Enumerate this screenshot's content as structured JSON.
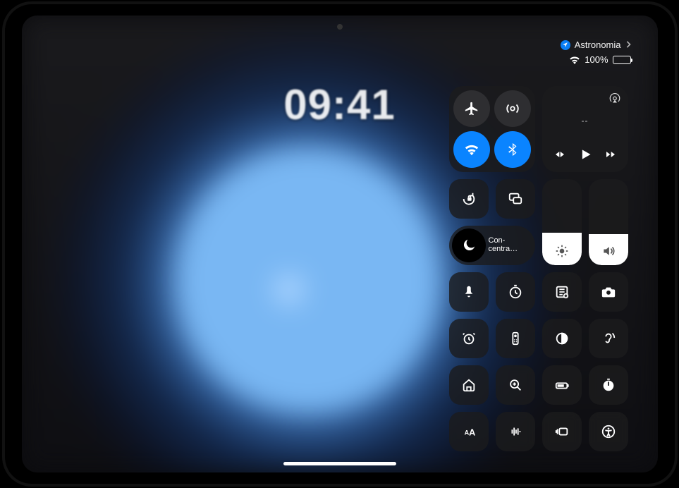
{
  "status": {
    "app_name": "Astronomia",
    "battery_text": "100%",
    "battery_level": 100
  },
  "clock": "09:41",
  "media": {
    "track_placeholder": "--"
  },
  "focus": {
    "label": "Con-\ncentra…"
  },
  "sliders": {
    "brightness_pct": 38,
    "volume_pct": 36
  },
  "controls": {
    "orientation_lock": "orientation-lock",
    "screen_mirroring": "screen-mirroring",
    "silent": "silent-mode",
    "timer": "timer",
    "notes": "quick-note",
    "camera": "camera",
    "alarm": "alarm",
    "remote": "apple-tv-remote",
    "dark_mode": "dark-mode",
    "hearing": "hearing",
    "home": "home",
    "magnifier": "magnifier",
    "low_power": "low-power-mode",
    "stopwatch": "stopwatch",
    "text_size": "text-size",
    "voice_memo": "voice-memo",
    "stage_manager": "stage-manager",
    "accessibility": "accessibility-shortcuts"
  }
}
